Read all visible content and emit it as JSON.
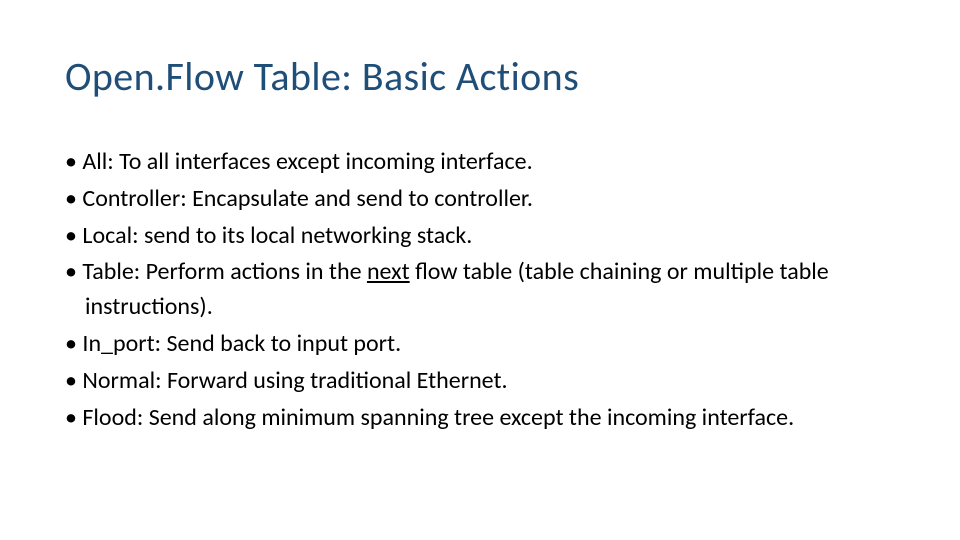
{
  "slide": {
    "title": "Open.Flow Table: Basic Actions",
    "items": [
      {
        "label": "All:",
        "text": " To all interfaces except incoming interface."
      },
      {
        "label": "Controller:",
        "text": " Encapsulate and send to controller."
      },
      {
        "label": "Local:",
        "text": " send to its local networking stack."
      },
      {
        "label": "Table:",
        "text_before": " Perform actions in the ",
        "underlined": "next",
        "text_after": " flow table (table chaining or multiple table instructions)."
      },
      {
        "label": "In_port:",
        "text": " Send back to input port."
      },
      {
        "label": "Normal:",
        "text": " Forward using traditional Ethernet."
      },
      {
        "label": "Flood:",
        "text": " Send along minimum spanning tree except the incoming interface."
      }
    ]
  }
}
